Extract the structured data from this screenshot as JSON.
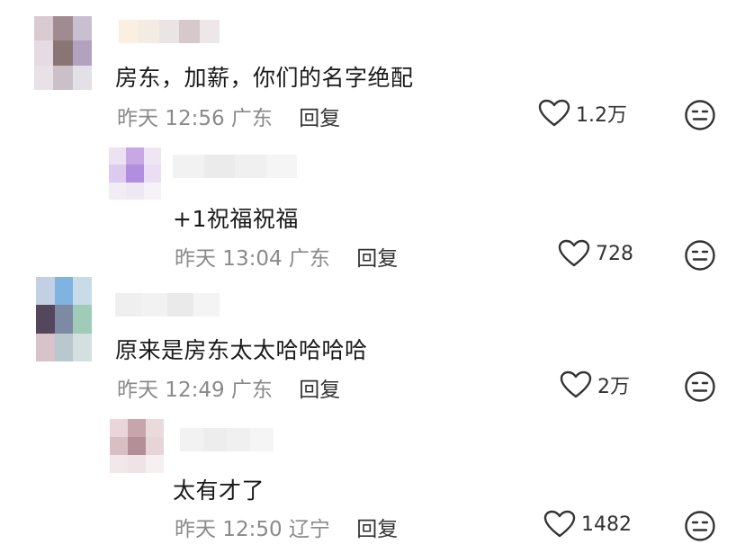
{
  "comments": [
    {
      "text": "房东，加薪，你们的名字绝配",
      "time": "昨天 12:56",
      "location": "广东",
      "reply_label": "回复",
      "likes": "1.2万",
      "avatar_colors": [
        "#d9cbd2",
        "#a08b93",
        "#c8bfd0",
        "#e7dbe3",
        "#8a7575",
        "#b2a2bf",
        "#e8e1e6",
        "#ccc0c8",
        "#e3e0e8"
      ],
      "name_colors": [
        "#fbefe2",
        "#f3ece2",
        "#ebe4e4",
        "#d7c9c9",
        "#ede7ea"
      ]
    },
    {
      "text": "+1祝福祝福",
      "time": "昨天 13:04",
      "location": "广东",
      "reply_label": "回复",
      "likes": "728",
      "avatar_colors": [
        "#ece2f2",
        "#c7a7e4",
        "#efe6f3",
        "#dccbee",
        "#b28ee0",
        "#e9def2",
        "#f2ecf5",
        "#eee8f3",
        "#f6f3f8"
      ],
      "name_colors": [
        "#f2f2f2",
        "#ebebeb",
        "#f0f0f0",
        "#f5f5f5"
      ]
    },
    {
      "text": "原来是房东太太哈哈哈哈",
      "time": "昨天 12:49",
      "location": "广东",
      "reply_label": "回复",
      "likes": "2万",
      "avatar_colors": [
        "#c3cfe3",
        "#7fb3e0",
        "#c9dae8",
        "#55475b",
        "#7d8aa3",
        "#9fcbb8",
        "#d7c3c9",
        "#b9c7cf",
        "#d4e0e0"
      ],
      "name_colors": [
        "#efefef",
        "#f2f2f2",
        "#eaeaea",
        "#f4f4f4"
      ]
    },
    {
      "text": "太有才了",
      "time": "昨天 12:50",
      "location": "辽宁",
      "reply_label": "回复",
      "likes": "1482",
      "avatar_colors": [
        "#ead6da",
        "#c7a5ad",
        "#eadadc",
        "#d8bfc4",
        "#b58f98",
        "#e6d4d7",
        "#f2e8ea",
        "#efe3e5",
        "#f6f0f1"
      ],
      "name_colors": [
        "#f2f2f2",
        "#ededed",
        "#f0f0f0",
        "#f5f5f5"
      ]
    }
  ]
}
